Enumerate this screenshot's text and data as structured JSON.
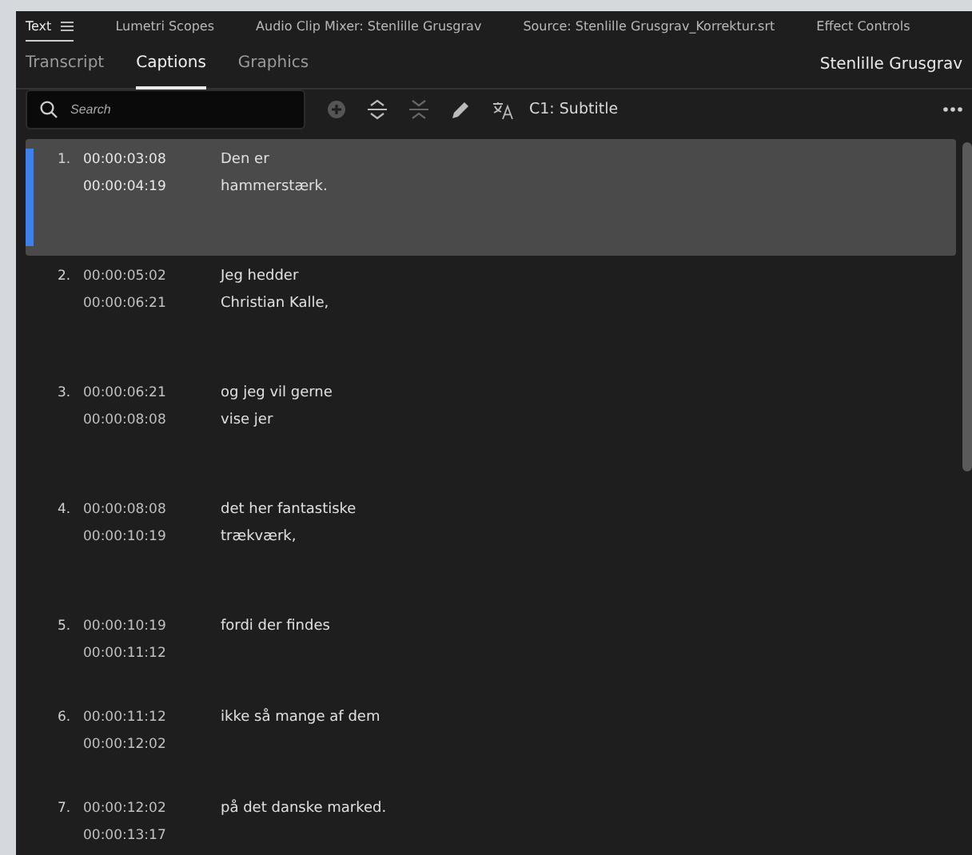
{
  "panel_tabs": [
    {
      "label": "Text",
      "selected": true,
      "menu": true
    },
    {
      "label": "Lumetri Scopes",
      "selected": false,
      "menu": false
    },
    {
      "label": "Audio Clip Mixer: Stenlille Grusgrav",
      "selected": false,
      "menu": false
    },
    {
      "label": "Source: Stenlille Grusgrav_Korrektur.srt",
      "selected": false,
      "menu": false
    },
    {
      "label": "Effect Controls",
      "selected": false,
      "menu": false
    }
  ],
  "sub_tabs": [
    {
      "label": "Transcript",
      "selected": false
    },
    {
      "label": "Captions",
      "selected": true
    },
    {
      "label": "Graphics",
      "selected": false
    }
  ],
  "sequence_name": "Stenlille Grusgrav",
  "search": {
    "placeholder": "Search"
  },
  "track_label": "C1: Subtitle",
  "captions": [
    {
      "number": "1.",
      "start": "00:00:03:08",
      "end": "00:00:04:19",
      "lines": [
        "Den er",
        "hammerstærk."
      ],
      "selected": true
    },
    {
      "number": "2.",
      "start": "00:00:05:02",
      "end": "00:00:06:21",
      "lines": [
        "Jeg hedder",
        "Christian Kalle,"
      ],
      "selected": false
    },
    {
      "number": "3.",
      "start": "00:00:06:21",
      "end": "00:00:08:08",
      "lines": [
        "og jeg vil gerne",
        "vise jer"
      ],
      "selected": false
    },
    {
      "number": "4.",
      "start": "00:00:08:08",
      "end": "00:00:10:19",
      "lines": [
        "det her fantastiske",
        "trækværk,"
      ],
      "selected": false
    },
    {
      "number": "5.",
      "start": "00:00:10:19",
      "end": "00:00:11:12",
      "lines": [
        "fordi der findes"
      ],
      "selected": false
    },
    {
      "number": "6.",
      "start": "00:00:11:12",
      "end": "00:00:12:02",
      "lines": [
        "ikke så mange af dem"
      ],
      "selected": false
    },
    {
      "number": "7.",
      "start": "00:00:12:02",
      "end": "00:00:13:17",
      "lines": [
        "på det danske marked."
      ],
      "selected": false
    }
  ]
}
